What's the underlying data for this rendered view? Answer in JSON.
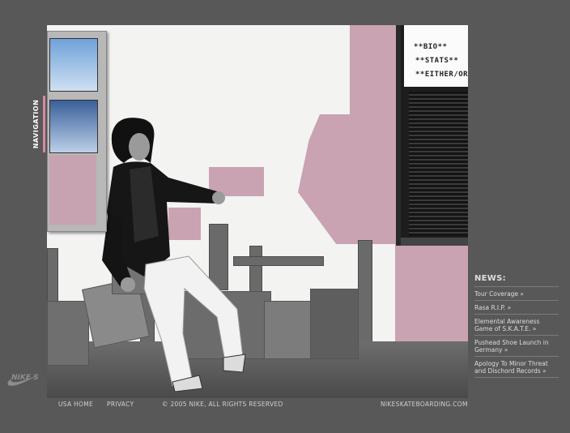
{
  "nav": {
    "label": "NAVIGATION"
  },
  "bio_links": [
    "**BIO**",
    "**STATS**",
    "**EITHER/OR**"
  ],
  "news": {
    "heading": "NEWS:",
    "items": [
      {
        "text": "Tour Coverage »"
      },
      {
        "text": "Rasa R.I.P. »"
      },
      {
        "text": "Elemental Awareness Game of S.K.A.T.E. »"
      },
      {
        "text": "Pushead Shoe Launch in Germany »"
      },
      {
        "text": "Apology To Minor Threat and Dischord Records »"
      }
    ]
  },
  "footer": {
    "usa_home": "USA HOME",
    "privacy": "PRIVACY",
    "copyright": "© 2005 NIKE, ALL RIGHTS RESERVED",
    "site": "NIKESKATEBOARDING.COM"
  },
  "logo": {
    "brand": "NIKE SB"
  },
  "colors": {
    "background": "#585858",
    "accent_pink": "#c9a3b1",
    "text": "#dcdcdc"
  }
}
